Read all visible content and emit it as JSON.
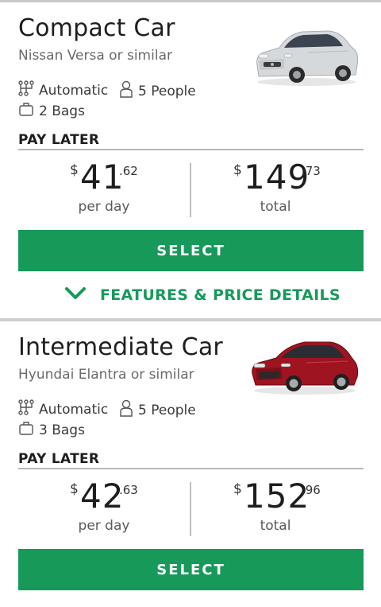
{
  "colors": {
    "accent": "#17995a",
    "divider": "#cfcfcf"
  },
  "cards": [
    {
      "title": "Compact Car",
      "subtitle": "Nissan Versa or similar",
      "car_color": "#d9dcdf",
      "transmission": "Automatic",
      "people": "5 People",
      "bags": "2 Bags",
      "pay_label": "PAY LATER",
      "per_day": {
        "currency": "$",
        "whole": "41",
        "cents": ".62",
        "unit": "per day"
      },
      "total": {
        "currency": "$",
        "whole": "149",
        "cents": ".73",
        "unit": "total"
      },
      "select_label": "SELECT",
      "features_label": "FEATURES & PRICE DETAILS",
      "features_icon": "chevron-down-icon"
    },
    {
      "title": "Intermediate Car",
      "subtitle": "Hyundai Elantra or similar",
      "car_color": "#9e1420",
      "transmission": "Automatic",
      "people": "5 People",
      "bags": "3 Bags",
      "pay_label": "PAY LATER",
      "per_day": {
        "currency": "$",
        "whole": "42",
        "cents": ".63",
        "unit": "per day"
      },
      "total": {
        "currency": "$",
        "whole": "152",
        "cents": ".96",
        "unit": "total"
      },
      "select_label": "SELECT"
    }
  ]
}
